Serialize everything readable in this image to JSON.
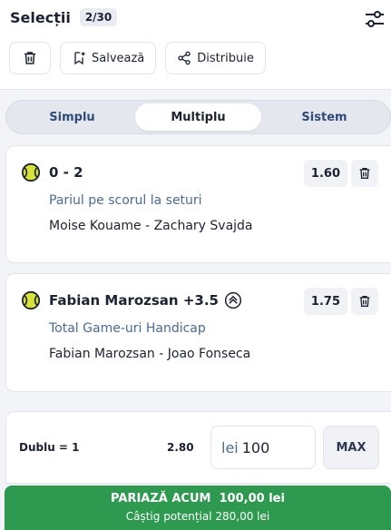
{
  "header": {
    "title": "Selecții",
    "count": "2/30",
    "icons": {
      "settings": "sliders-icon"
    }
  },
  "actions": {
    "delete_icon": "trash-icon",
    "save_label": "Salvează",
    "share_label": "Distribuie"
  },
  "tabs": [
    {
      "label": "Simplu",
      "active": false
    },
    {
      "label": "Multiplu",
      "active": true
    },
    {
      "label": "Sistem",
      "active": false
    }
  ],
  "selections": [
    {
      "name": "0 - 2",
      "odd": "1.60",
      "market": "Pariul pe scorul la seturi",
      "match": "Moise Kouame - Zachary Svajda",
      "sport_icon": "tennis-ball-icon"
    },
    {
      "name": "Fabian Marozsan +3.5",
      "odd": "1.75",
      "market": "Total Game-uri Handicap",
      "match": "Fabian Marozsan - Joao Fonseca",
      "sport_icon": "tennis-ball-icon",
      "badge_icon": "boost-icon"
    }
  ],
  "stake": {
    "bet_label": "Dublu = 1",
    "bet_odd": "2.80",
    "currency": "lei",
    "amount": "100",
    "max_label": "MAX"
  },
  "place_bet": {
    "line1": "PARIAZĂ ACUM  100,00 lei",
    "line2": "Câștig potențial 280,00 lei"
  },
  "colors": {
    "accent_green": "#2e9a4f",
    "text_blue": "#4a6a98",
    "tennis_yellow": "#d7e23a"
  }
}
